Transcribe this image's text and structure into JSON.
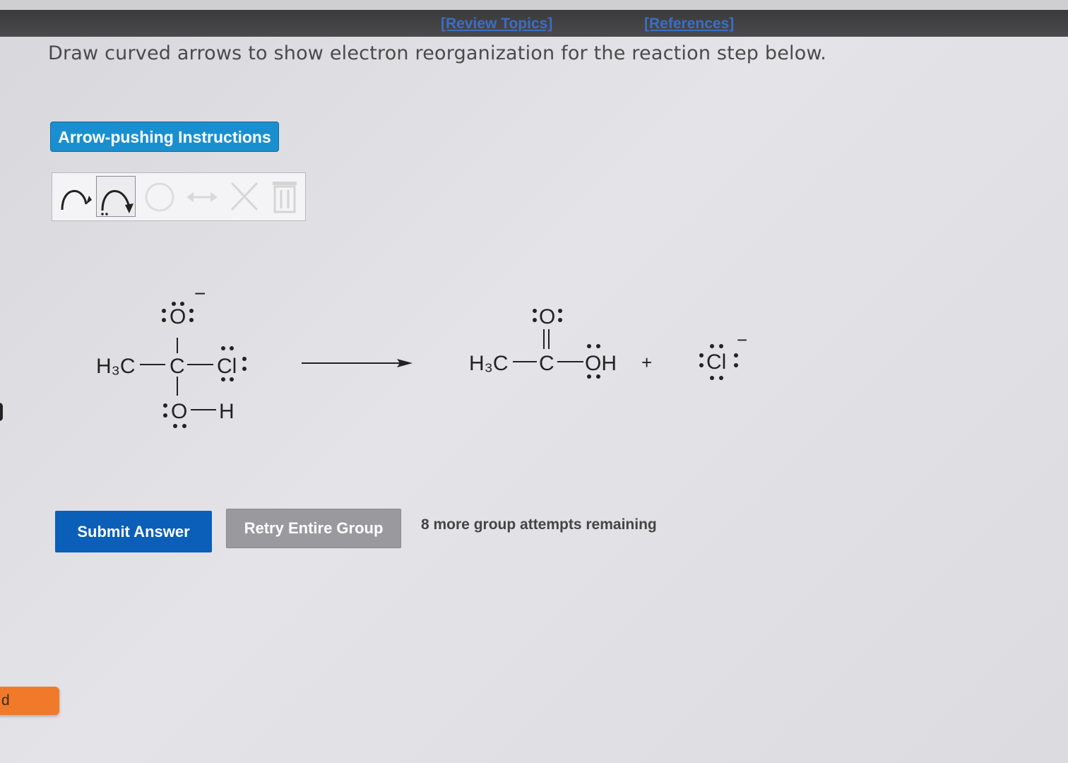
{
  "header": {
    "review_topics": "[Review Topics]",
    "references": "[References]"
  },
  "prompt": "Draw curved arrows to show electron reorganization for the reaction step below.",
  "instructions_button": "Arrow-pushing Instructions",
  "toolbar": {
    "tools": [
      {
        "name": "single-electron-arrow-icon",
        "state": "enabled"
      },
      {
        "name": "electron-pair-arrow-icon",
        "state": "selected"
      },
      {
        "name": "circle-icon",
        "state": "disabled"
      },
      {
        "name": "double-arrow-icon",
        "state": "disabled"
      },
      {
        "name": "delete-x-icon",
        "state": "disabled"
      },
      {
        "name": "trash-icon",
        "state": "disabled"
      }
    ]
  },
  "reactant": {
    "h3c": "H₃C",
    "c": "C",
    "o_top": "O",
    "cl": "Cl",
    "o_bottom": "O",
    "h": "H",
    "charge": "−"
  },
  "product": {
    "h3c": "H₃C",
    "c": "C",
    "o_top": "O",
    "oh": "OH",
    "plus": "+",
    "cl": "Cl",
    "charge": "−"
  },
  "buttons": {
    "submit": "Submit Answer",
    "retry": "Retry Entire Group"
  },
  "attempts_text": "8 more group attempts remaining",
  "side_tab_text": "d",
  "colors": {
    "link": "#3b6ec4",
    "instr_button": "#1a8fd0",
    "submit_button": "#0b5fb8",
    "retry_button": "#9a9a9e",
    "side_tab": "#f07a2a"
  }
}
